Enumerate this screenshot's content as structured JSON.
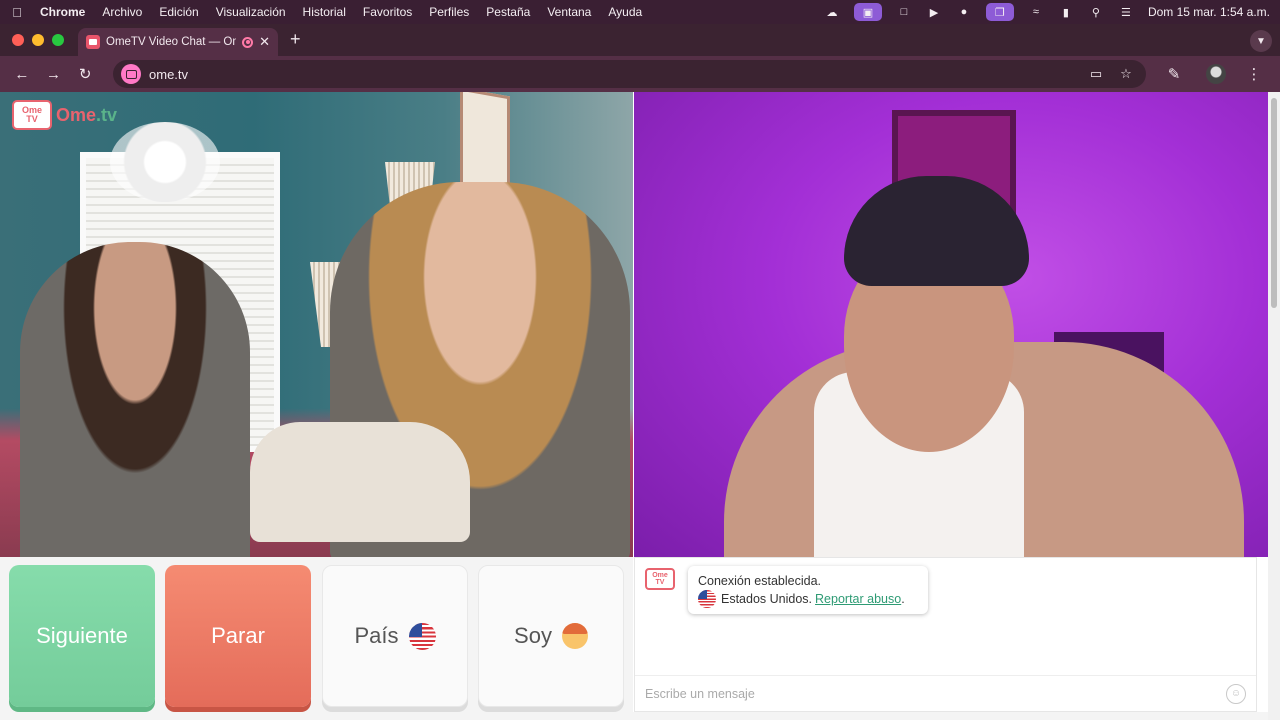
{
  "menubar": {
    "app": "Chrome",
    "items": [
      "Archivo",
      "Edición",
      "Visualización",
      "Historial",
      "Favoritos",
      "Perfiles",
      "Pestaña",
      "Ventana",
      "Ayuda"
    ],
    "clock": "Dom 15 mar.  1:54 a.m."
  },
  "browser": {
    "tab_title": "OmeTV Video Chat — Om",
    "new_tab": "+",
    "url": "ome.tv"
  },
  "page": {
    "logo": {
      "tv_top": "Ome",
      "tv_bottom": "TV",
      "word": "Ome",
      "tld": ".tv"
    },
    "buttons": {
      "next": "Siguiente",
      "stop": "Parar",
      "country": "País",
      "soy": "Soy"
    },
    "chat": {
      "logo_top": "Ome",
      "logo_bottom": "TV",
      "status": "Conexión establecida.",
      "country": "Estados Unidos.",
      "report": "Reportar abuso",
      "period": ".",
      "placeholder": "Escribe un mensaje"
    }
  },
  "colors": {
    "next": "#7fd6a5",
    "stop": "#ef7c66",
    "brand": "#e8636e",
    "link": "#2e9b74"
  }
}
